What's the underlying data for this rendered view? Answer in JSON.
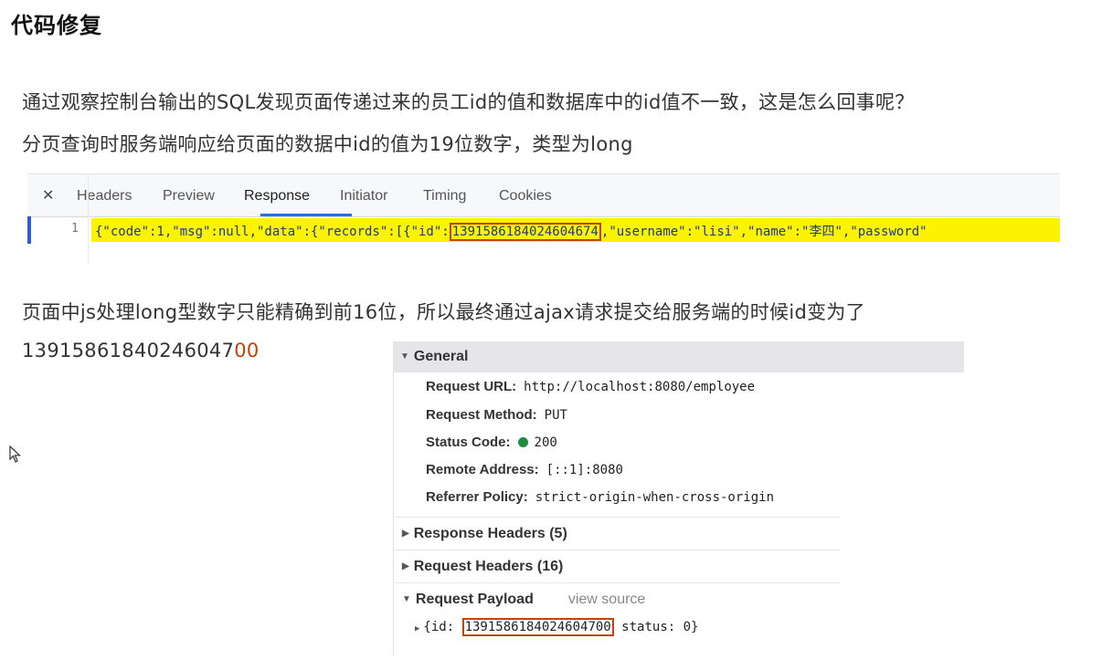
{
  "page": {
    "title": "代码修复",
    "para1": "通过观察控制台输出的SQL发现页面传递过来的员工id的值和数据库中的id值不一致，这是怎么回事呢？",
    "para2": "分页查询时服务端响应给页面的数据中id的值为19位数字，类型为long",
    "para3": "页面中js处理long型数字只能精确到前16位，所以最终通过ajax请求提交给服务端的时候id变为了",
    "para4_prefix": "13915861840246047",
    "para4_suffix": "00"
  },
  "devtools": {
    "close_glyph": "✕",
    "tabs": [
      "Headers",
      "Preview",
      "Response",
      "Initiator",
      "Timing",
      "Cookies"
    ],
    "active_tab": "Response",
    "line_number": "1",
    "code_prefix": "{\"code\":1,\"msg\":null,\"data\":{\"records\":[{\"id\":",
    "code_id": "1391586184024604674",
    "code_suffix": ",\"username\":\"lisi\",\"name\":\"李四\",\"password\"",
    "highlight_color": "#fbf300"
  },
  "general": {
    "header": "General",
    "rows": [
      {
        "key": "Request URL:",
        "value": "http://localhost:8080/employee"
      },
      {
        "key": "Request Method:",
        "value": "PUT"
      },
      {
        "key": "Status Code:",
        "value": "200",
        "status_icon": "green-dot-icon"
      },
      {
        "key": "Remote Address:",
        "value": "[::1]:8080"
      },
      {
        "key": "Referrer Policy:",
        "value": "strict-origin-when-cross-origin"
      }
    ],
    "response_headers": "Response Headers (5)",
    "request_headers": "Request Headers (16)",
    "request_payload": "Request Payload",
    "view_source": "view source",
    "payload_prefix": "{id:",
    "payload_id": "1391586184024604700",
    "payload_suffix": "status: 0}"
  },
  "colors": {
    "accent_tab": "#1a73e8",
    "highlight_box": "#c2410c",
    "status_ok": "#1e8e3e"
  }
}
